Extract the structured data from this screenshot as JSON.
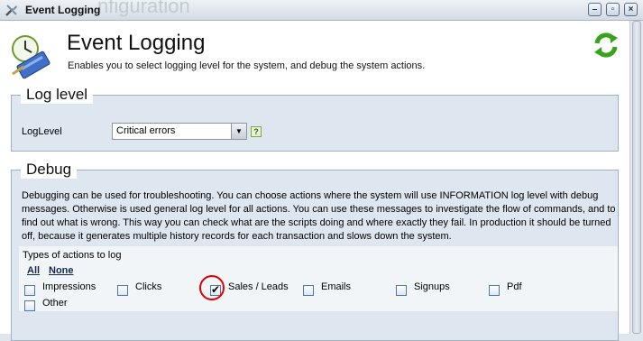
{
  "window": {
    "title": "Event Logging",
    "background_text": "nfiguration"
  },
  "header": {
    "title": "Event Logging",
    "subtitle": "Enables you to select logging level for the system, and debug the system actions."
  },
  "log_level": {
    "legend": "Log level",
    "field_label": "LogLevel",
    "selected": "Critical errors",
    "help": "?"
  },
  "debug": {
    "legend": "Debug",
    "description": "Debugging can be used for troubleshooting. You can choose actions where the system will use INFORMATION log level with debug messages. Otherwise is used general log level for all actions. You can use these messages to investigate the flow of commands, and to find out what is wrong. This way you can check what are the scripts doing and where exactly they fail. In production it should be turned off, because it generates multiple history records for each transaction and slows down the system.",
    "types_title": "Types of actions to log",
    "all_link": "All",
    "none_link": "None",
    "actions": [
      {
        "label": "Impressions",
        "checked": false
      },
      {
        "label": "Clicks",
        "checked": false
      },
      {
        "label": "Sales / Leads",
        "checked": true
      },
      {
        "label": "Emails",
        "checked": false
      },
      {
        "label": "Signups",
        "checked": false
      },
      {
        "label": "Pdf",
        "checked": false
      },
      {
        "label": "Other",
        "checked": false
      }
    ]
  },
  "colors": {
    "annotation_circle": "#e00000",
    "panel_background": "#dee6ef",
    "panel_border": "#9fb0c4"
  }
}
